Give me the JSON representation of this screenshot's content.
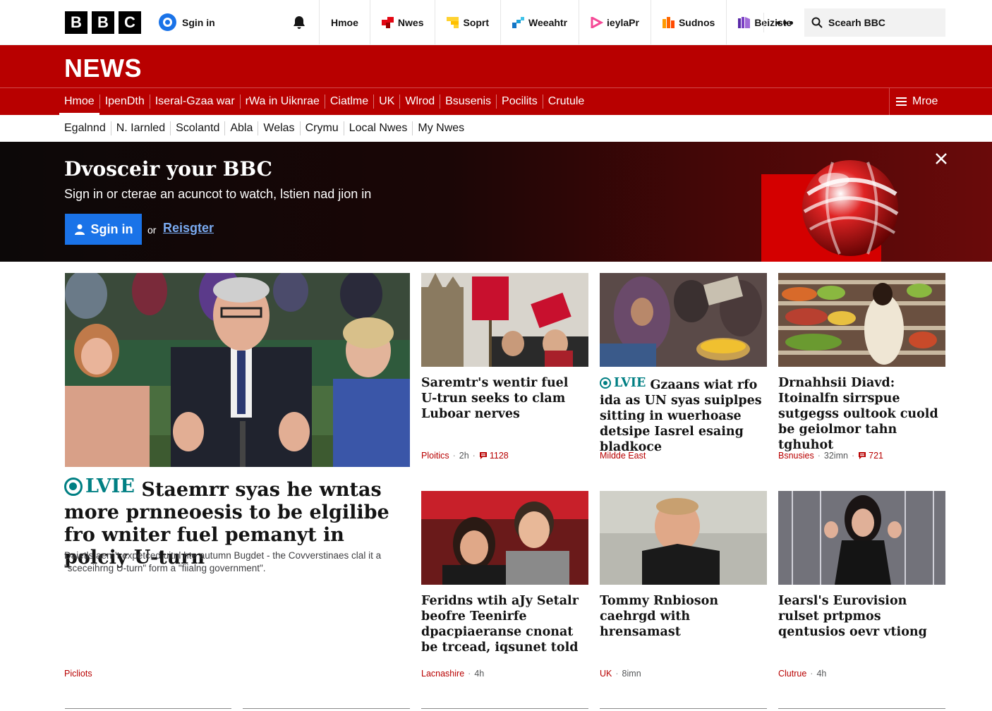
{
  "brand": {
    "letters": [
      "B",
      "B",
      "C"
    ]
  },
  "top": {
    "signin_label": "Sgin in",
    "nav": [
      {
        "label": "Hmoe",
        "icon": "home-icon",
        "color": ""
      },
      {
        "label": "Nwes",
        "icon": "news-icon",
        "color": "#e30613"
      },
      {
        "label": "Soprt",
        "icon": "sport-icon",
        "color": "#ffd230"
      },
      {
        "label": "Weeahtr",
        "icon": "weather-icon",
        "color": "#1375c6"
      },
      {
        "label": "ieylaPr",
        "icon": "iplayer-icon",
        "color": "#f54996"
      },
      {
        "label": "Sudnos",
        "icon": "sounds-icon",
        "color": "#ff6600"
      },
      {
        "label": "Beiziste",
        "icon": "bitesize-icon",
        "color": "#7b3fc4"
      }
    ],
    "search_placeholder": "Scearh BBC"
  },
  "news": {
    "title": "NEWS",
    "main_nav": [
      "Hmoe",
      "IpenDth",
      "Iseral-Gzaa war",
      "rWa in Uiknrae",
      "Ciatlme",
      "UK",
      "Wlrod",
      "Bsusenis",
      "Pocilits",
      "Crutule"
    ],
    "more_label": "Mroe",
    "sub_nav": [
      "Egalnnd",
      "N. Iarnled",
      "Scolantd",
      "Abla",
      "Welas",
      "Crymu",
      "Local Nwes",
      "My Nwes"
    ]
  },
  "promo": {
    "title": "Dvosceir your BBC",
    "subtitle": "Sign in or cterae an acuncot to watch, lstien nad jion in",
    "signin_label": "Sgin in",
    "or_label": "or",
    "register_label": "Reisgter"
  },
  "live_label": "LVIE",
  "main_story": {
    "headline": "Staemrr syas he wntas more prnneoesis to be elgilibe fro wniter fuel pemanyt in polciy U-turn",
    "summary": "Daietls aern't expetced uitnl hte autumn Bugdet - the Covverstinaes clal it a \"sceceihrng U-turn\" form a \"fiialng government\".",
    "category": "Picliots"
  },
  "stories": [
    {
      "headline": "Saremtr's wentir fuel U-trun seeks to clam Luboar nerves",
      "category": "Ploitics",
      "time": "2h",
      "comments": "1128",
      "live": false
    },
    {
      "headline": "Gzaans wiat rfo ida as UN syas suiplpes sitting in wuerhoase detsipe Iasrel esaing bladkoce",
      "category": "Mildde East",
      "time": "",
      "comments": "",
      "live": true
    },
    {
      "headline": "Drnahhsii Diavd: Itoinalfn sirrspue sutgegss oultook cuold be geiolmor tahn tghuhot",
      "category": "Bsnusies",
      "time": "32imn",
      "comments": "721",
      "live": false
    },
    {
      "headline": "Feridns wtih aJy Setalr beofre Teenirfe dpacpiaeranse cnonat be trcead, iqsunet told",
      "category": "Lacnashire",
      "time": "4h",
      "comments": "",
      "live": false
    },
    {
      "headline": "Tommy Rnbioson caehrgd with hrensamast",
      "category": "UK",
      "time": "8imn",
      "comments": "",
      "live": false
    },
    {
      "headline": "Iearsl's Eurovision rulset prtpmos qentusios oevr vtiong",
      "category": "Clutrue",
      "time": "4h",
      "comments": "",
      "live": false
    }
  ],
  "colors": {
    "brand_red": "#b80000",
    "live_teal": "#007f83",
    "signin_blue": "#1a73e8"
  }
}
